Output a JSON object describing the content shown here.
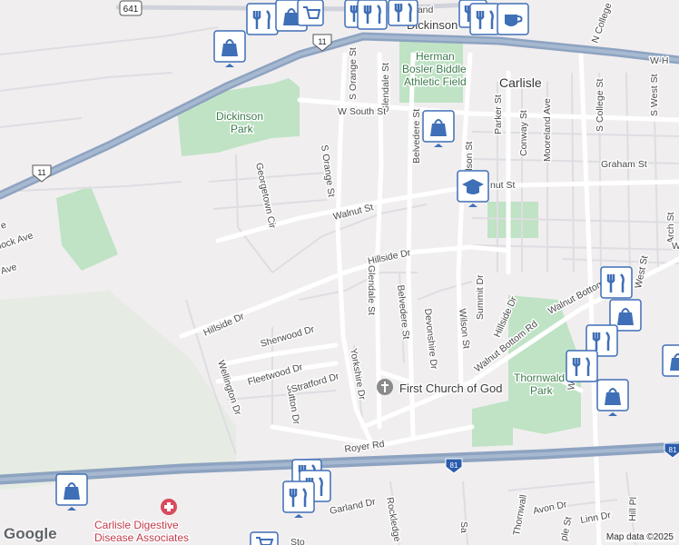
{
  "map": {
    "attribution": "Map data ©2025",
    "logo": "Google",
    "colors": {
      "background": "#f1eef0",
      "park": "#bfe3c4",
      "highway": "#8da3c0",
      "road": "#ffffff",
      "minor_road": "#d7d8dc",
      "pin": "#3f6fb6"
    },
    "labels": {
      "garland_top": "Garland",
      "dickinson_top": "Dickinson",
      "herman": "Herman",
      "bosler_biddle": "Bosler Biddle",
      "athletic_field": "Athletic Field",
      "carlisle": "Carlisle",
      "n_college": "N College",
      "w_h": "W H",
      "dickinson_park_1": "Dickinson",
      "dickinson_park_2": "Park",
      "s_orange_st_top": "S Orange St",
      "glendale_st_top": "Glendale St",
      "belvedere_st_top": "Belvedere St",
      "wilson_st_top": "Wilson St",
      "parker_st": "Parker St",
      "conway_st": "Conway St",
      "mooreland_ave": "Mooreland Ave",
      "s_college_st": "S College St",
      "s_west_st": "S West St",
      "w_south_st": "W South St",
      "graham_st": "Graham St",
      "walnut_st_right": "nut St",
      "s_orange_st_mid": "S Orange St",
      "georgetown_cir": "Georgetown Cir",
      "walnut_st": "Walnut St",
      "hillside_dr_top": "Hillside Dr",
      "hillside_dr_left": "Hillside Dr",
      "glendale_st_mid": "Glendale St",
      "belvedere_st_mid": "Belvedere St",
      "devonshire_dr": "Devonshire Dr",
      "wilson_st_mid": "Wilson St",
      "summit_dr": "Summit Dr",
      "hillside_dr_right": "Hillside Dr",
      "walnut_bottom_rd_1": "Walnut Bottom Rd",
      "walnut_bottom_rd_2": "Walnut Bottom Rd",
      "arch_st": "Arch St",
      "w_right": "W",
      "west_st_right": "West St",
      "sherwood_dr": "Sherwood Dr",
      "fleetwood_dr": "Fleetwood Dr",
      "sutton_dr": "Sutton Dr",
      "stratford_dr": "Stratford Dr",
      "yorkshire_dr": "Yorkshire Dr",
      "wellington_dr": "Wellington Dr",
      "first_church": "First Church of God",
      "thornwald_1": "Thornwald",
      "thornwald_2": "Park",
      "w_r": "W R",
      "royer_rd": "Royer Rd",
      "garland_dr": "Garland Dr",
      "rockledge": "Rockledge",
      "sa": "Sa",
      "avon_dr": "Avon Dr",
      "linn_dr": "Linn Dr",
      "hill_pl": "Hill Pl",
      "ple_st": "ple St",
      "thornwall_bottom": "Thornwall",
      "sto": "Sto",
      "ave_left": "e",
      "lock_ave": "lock Ave",
      "ave_left2": "Ave",
      "route_641": "641",
      "route_11_top": "11",
      "route_11_left": "11",
      "route_81_center": "81",
      "route_81_right": "81",
      "hospital_1": "Carlisle Digestive",
      "hospital_2": "Disease Associates"
    }
  }
}
